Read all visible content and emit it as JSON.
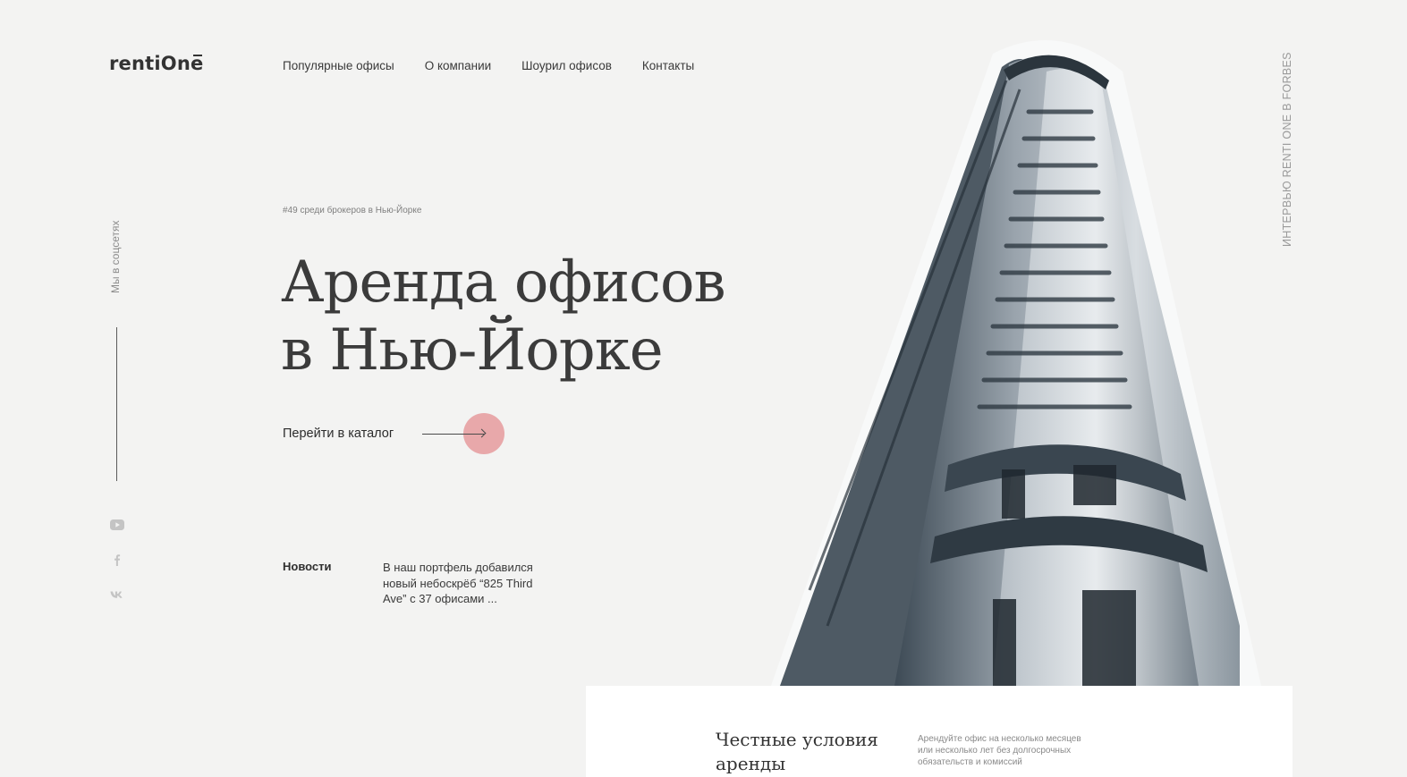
{
  "brand": {
    "logo": "rentiOne"
  },
  "nav": {
    "items": [
      {
        "label": "Популярные офисы"
      },
      {
        "label": "О компании"
      },
      {
        "label": "Шоурил офисов"
      },
      {
        "label": "Контакты"
      }
    ]
  },
  "social": {
    "label": "Мы в соцсетях",
    "icons": [
      "youtube-icon",
      "facebook-icon",
      "vk-icon"
    ]
  },
  "side_link": {
    "label": "ИНТЕРВЬЮ RENTI ONE В FORBES"
  },
  "hero": {
    "rank": "#49 среди брокеров в Нью-Йорке",
    "title_line1": "Аренда офисов",
    "title_line2": "в Нью-Йорке",
    "cta_label": "Перейти в каталог"
  },
  "news": {
    "label": "Новости",
    "text": "В наш портфель добавился новый небоскрёб “825 Third Ave” с 37 офисами ..."
  },
  "card": {
    "title": "Честные условия аренды",
    "text": "Арендуйте офис на несколько месяцев или несколько лет без долгосрочных обязательств и комиссий"
  },
  "colors": {
    "background": "#f3f3f2",
    "accent": "#e8a8aa",
    "text": "#333333",
    "card": "#ffffff"
  }
}
